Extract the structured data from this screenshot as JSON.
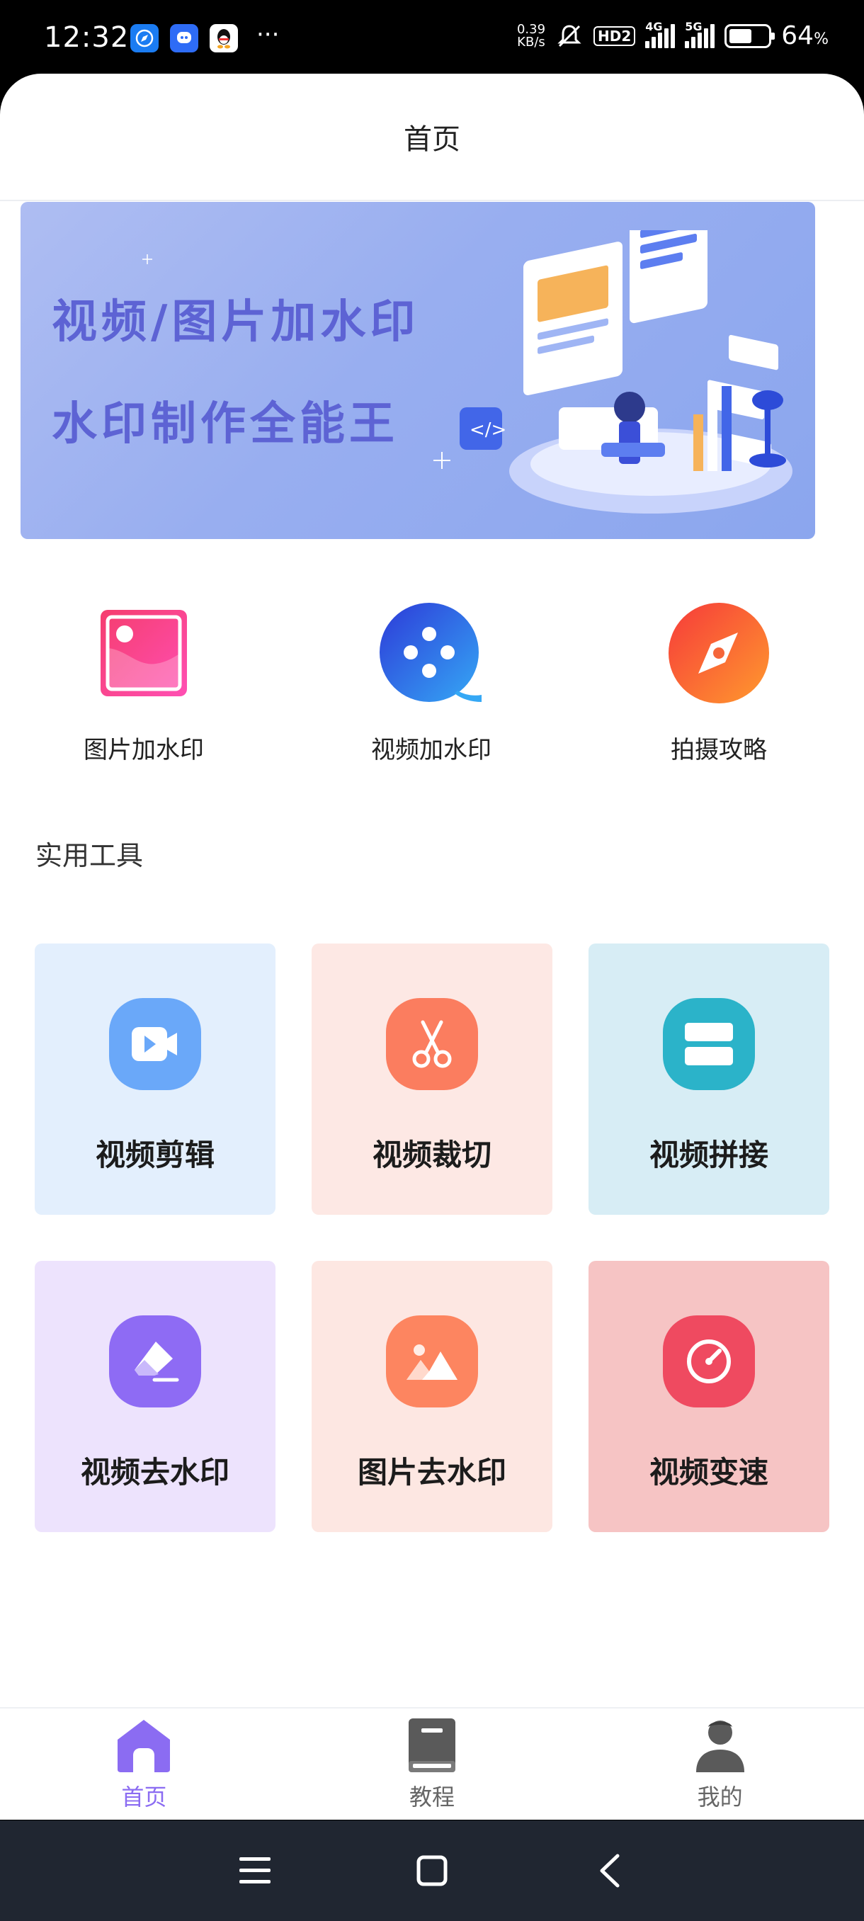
{
  "status_bar": {
    "time": "12:32",
    "speed_value": "0.39",
    "speed_unit": "KB/s",
    "hd_label": "HD2",
    "net1": "4G",
    "net2": "5G",
    "battery_pct": "64",
    "battery_unit": "%",
    "overflow_dots": "···"
  },
  "header": {
    "title": "首页"
  },
  "banner": {
    "line1": "视频/图片加水印",
    "line2": "水印制作全能王"
  },
  "quick_actions": [
    {
      "label": "图片加水印",
      "icon": "image-watermark-icon"
    },
    {
      "label": "视频加水印",
      "icon": "video-watermark-icon"
    },
    {
      "label": "拍摄攻略",
      "icon": "compass-icon"
    }
  ],
  "tools_section": {
    "title": "实用工具"
  },
  "tools": [
    {
      "label": "视频剪辑",
      "icon": "video-camera-icon",
      "bg": "#e3effd",
      "icon_bg": "#6aa8f9"
    },
    {
      "label": "视频裁切",
      "icon": "scissors-icon",
      "bg": "#fde8e4",
      "icon_bg": "#fb7d5f"
    },
    {
      "label": "视频拼接",
      "icon": "merge-icon",
      "bg": "#d7edf5",
      "icon_bg": "#2bb3c9"
    },
    {
      "label": "视频去水印",
      "icon": "eraser-icon",
      "bg": "#ede3fd",
      "icon_bg": "#8e6bf4"
    },
    {
      "label": "图片去水印",
      "icon": "picture-icon",
      "bg": "#fde7e2",
      "icon_bg": "#fd8560"
    },
    {
      "label": "视频变速",
      "icon": "speedometer-icon",
      "bg": "#f6c4c4",
      "icon_bg": "#ef4a60"
    }
  ],
  "tabbar": {
    "items": [
      {
        "label": "首页",
        "icon": "home-icon",
        "active": true
      },
      {
        "label": "教程",
        "icon": "book-icon",
        "active": false
      },
      {
        "label": "我的",
        "icon": "user-icon",
        "active": false
      }
    ]
  },
  "colors": {
    "accent": "#8b6cf2",
    "navbar_bg": "#202631"
  }
}
